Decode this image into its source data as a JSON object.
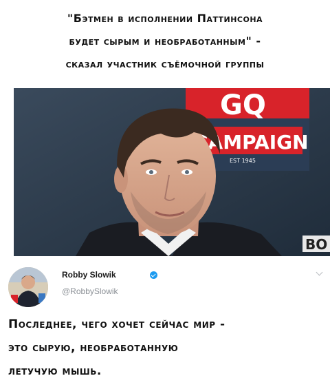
{
  "headline": {
    "lines": [
      "\"Бэтмен в исполнении Паттинсона",
      "будет сырым и необработанным\" -",
      "сказал участник съёмочной группы"
    ]
  },
  "photo": {
    "backdrop_text": [
      "GQ",
      "CAMPAIGN",
      "EST 1945",
      "BO"
    ]
  },
  "tweet": {
    "author_name": "Robby Slowik",
    "author_handle": "@RobbySlowik",
    "text_lines": [
      "Последнее, чего хочет сейчас мир -",
      "это сырую, необработанную",
      "летучую мышь."
    ]
  }
}
